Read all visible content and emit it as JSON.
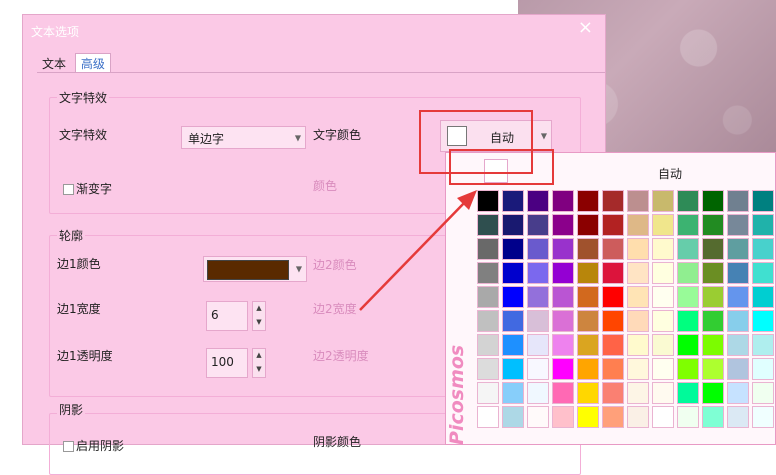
{
  "dialog": {
    "title": "文本选项",
    "close_glyph": "×",
    "tabs": [
      {
        "label": "文本",
        "active": false
      },
      {
        "label": "高级",
        "active": true
      }
    ]
  },
  "text_effects": {
    "group_title": "文字特效",
    "effect_label": "文字特效",
    "effect_value": "单边字",
    "text_color_label": "文字颜色",
    "text_color_value": "自动",
    "gradient_label": "渐变字",
    "gradient_color_label": "颜色"
  },
  "outline": {
    "group_title": "轮廓",
    "edge1_color_label": "边1颜色",
    "edge1_color": "#5a2a00",
    "edge2_color_label": "边2颜色",
    "edge1_width_label": "边1宽度",
    "edge1_width_value": "6",
    "edge2_width_label": "边2宽度",
    "edge1_opacity_label": "边1透明度",
    "edge1_opacity_value": "100",
    "edge2_opacity_label": "边2透明度"
  },
  "shadow": {
    "group_title": "阴影",
    "enable_label": "启用阴影",
    "shadow_color_label": "阴影颜色"
  },
  "color_popup": {
    "auto_label": "自动",
    "watermark": "Picosmos",
    "palette": [
      [
        "#000000",
        "#1a1a7a",
        "#4b0082",
        "#800080",
        "#8b0000",
        "#a52a2a",
        "#bc8f8f",
        "#c8b96c",
        "#2e8b57",
        "#006400",
        "#708090",
        "#008080",
        "#0000ff"
      ],
      [
        "#2f4f4f",
        "#191970",
        "#483d8b",
        "#8b008b",
        "#8b0000",
        "#b22222",
        "#deb887",
        "#f0e68c",
        "#3cb371",
        "#228b22",
        "#778899",
        "#20b2aa",
        "#1e90ff"
      ],
      [
        "#696969",
        "#00008b",
        "#6a5acd",
        "#9932cc",
        "#a0522d",
        "#cd5c5c",
        "#ffdead",
        "#fffacd",
        "#66cdaa",
        "#556b2f",
        "#5f9ea0",
        "#48d1cc",
        "#4169e1"
      ],
      [
        "#808080",
        "#0000cd",
        "#7b68ee",
        "#9400d3",
        "#b8860b",
        "#dc143c",
        "#ffe4c4",
        "#ffffe0",
        "#90ee90",
        "#6b8e23",
        "#4682b4",
        "#40e0d0",
        "#6495ed"
      ],
      [
        "#a9a9a9",
        "#0000ff",
        "#9370db",
        "#ba55d3",
        "#d2691e",
        "#ff0000",
        "#ffe4b5",
        "#fffff0",
        "#98fb98",
        "#9acd32",
        "#6495ed",
        "#00ced1",
        "#87cefa"
      ],
      [
        "#c0c0c0",
        "#4169e1",
        "#d8bfd8",
        "#da70d6",
        "#cd853f",
        "#ff4500",
        "#ffdab9",
        "#ffffe0",
        "#00ff7f",
        "#32cd32",
        "#87ceeb",
        "#00ffff",
        "#b0e0e6"
      ],
      [
        "#d3d3d3",
        "#1e90ff",
        "#e6e6fa",
        "#ee82ee",
        "#daa520",
        "#ff6347",
        "#fffacd",
        "#fafad2",
        "#00ff00",
        "#7cfc00",
        "#add8e6",
        "#afeeee",
        "#e0ffff"
      ],
      [
        "#dcdcdc",
        "#00bfff",
        "#f8f8ff",
        "#ff00ff",
        "#ffa500",
        "#ff7f50",
        "#fff8dc",
        "#fffff0",
        "#7fff00",
        "#adff2f",
        "#b0c4de",
        "#e0ffff",
        "#f0ffff"
      ],
      [
        "#f5f5f5",
        "#87cefa",
        "#f0f8ff",
        "#ff69b4",
        "#ffd700",
        "#fa8072",
        "#fdf5e6",
        "#fffaf0",
        "#00fa9a",
        "#00ff00",
        "#c6e2ff",
        "#f0fff0",
        "#f5fffa"
      ],
      [
        "#ffffff",
        "#add8e6",
        "#fffafa",
        "#ffc0cb",
        "#ffff00",
        "#ffa07a",
        "#faf0e6",
        "#ffffff",
        "#f0fff0",
        "#7fffd4",
        "#dbe9f4",
        "#f0ffff",
        "#ffffff"
      ]
    ]
  }
}
